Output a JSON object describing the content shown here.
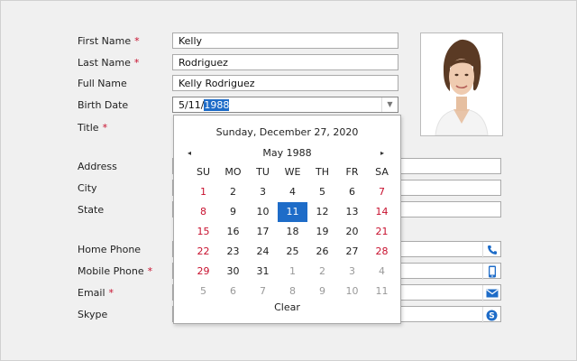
{
  "form": {
    "labels": {
      "first_name": "First Name",
      "last_name": "Last Name",
      "full_name": "Full Name",
      "birth_date": "Birth Date",
      "title": "Title",
      "address": "Address",
      "city": "City",
      "state": "State",
      "home_phone": "Home Phone",
      "mobile_phone": "Mobile Phone",
      "email": "Email",
      "skype": "Skype"
    },
    "required_mark": "*",
    "values": {
      "first_name": "Kelly",
      "last_name": "Rodriguez",
      "full_name": "Kelly Rodriguez",
      "birth_date_prefix": "5/11/",
      "birth_date_selected": "1988"
    }
  },
  "calendar": {
    "today_text": "Sunday, December 27, 2020",
    "month_label": "May 1988",
    "prev_symbol": "◂",
    "next_symbol": "▸",
    "weekdays": [
      "SU",
      "MO",
      "TU",
      "WE",
      "TH",
      "FR",
      "SA"
    ],
    "weeks": [
      [
        "1",
        "2",
        "3",
        "4",
        "5",
        "6",
        "7"
      ],
      [
        "8",
        "9",
        "10",
        "11",
        "12",
        "13",
        "14"
      ],
      [
        "15",
        "16",
        "17",
        "18",
        "19",
        "20",
        "21"
      ],
      [
        "22",
        "23",
        "24",
        "25",
        "26",
        "27",
        "28"
      ],
      [
        "29",
        "30",
        "31",
        "1",
        "2",
        "3",
        "4"
      ],
      [
        "5",
        "6",
        "7",
        "8",
        "9",
        "10",
        "11"
      ]
    ],
    "selected_day": "11",
    "clear_label": "Clear"
  },
  "colors": {
    "accent": "#1e6cc8",
    "required": "#c8102e",
    "weekend": "#c8102e"
  },
  "icons": {
    "home_phone": "phone-icon",
    "mobile_phone": "mobile-icon",
    "email": "envelope-icon",
    "skype": "skype-icon"
  }
}
